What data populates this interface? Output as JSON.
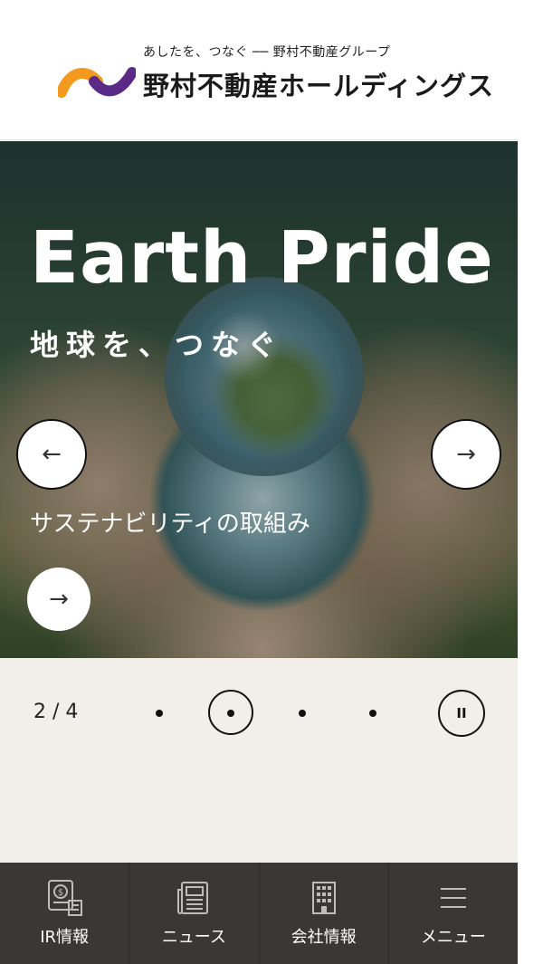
{
  "header": {
    "tagline": "あしたを、つなぐ ── 野村不動産グループ",
    "company_name": "野村不動産ホールディングス",
    "logo_icon": "nomura-wave-logo-icon"
  },
  "hero": {
    "title": "Earth Pride",
    "subtitle": "地球を、つなぐ",
    "link_text": "サステナビリティの取組み",
    "prev_icon": "arrow-left-icon",
    "next_icon": "arrow-right-icon",
    "go_icon": "arrow-right-icon"
  },
  "carousel": {
    "counter": "2 / 4",
    "current_slide": 2,
    "total_slides": 4,
    "pause_icon": "pause-icon"
  },
  "bottom_nav": {
    "items": [
      {
        "label": "IR情報",
        "icon": "ir-document-icon"
      },
      {
        "label": "ニュース",
        "icon": "newspaper-icon"
      },
      {
        "label": "会社情報",
        "icon": "building-icon"
      },
      {
        "label": "メニュー",
        "icon": "hamburger-menu-icon"
      }
    ]
  },
  "colors": {
    "logo_orange": "#f39a1e",
    "logo_purple": "#5b2a86",
    "controls_bg": "#f2efeb",
    "nav_bg": "#3a3837"
  },
  "glyphs": {
    "arrow_left": "←",
    "arrow_right": "→",
    "pause": "II"
  }
}
